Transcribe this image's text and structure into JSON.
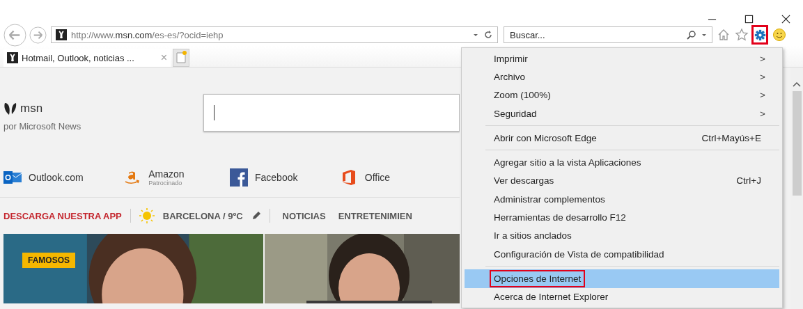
{
  "address_bar": {
    "url": "http://www.**msn.com**/es-es/?ocid=iehp"
  },
  "search": {
    "placeholder": "Buscar..."
  },
  "toolbar": {
    "gear_highlighted": true
  },
  "tabs": [
    {
      "title": "Hotmail, Outlook, noticias ...",
      "selected": true,
      "close": "×"
    }
  ],
  "page": {
    "logo": "msn",
    "tagline": "por Microsoft News",
    "links": [
      {
        "label": "Outlook.com",
        "kind": "outlook"
      },
      {
        "label": "Amazon",
        "sublabel": "Patrocinado",
        "kind": "amazon"
      },
      {
        "label": "Facebook",
        "kind": "facebook"
      },
      {
        "label": "Office",
        "kind": "office"
      }
    ],
    "nav": [
      {
        "label": "DESCARGA NUESTRA APP",
        "kind": "promo"
      },
      {
        "label": "BARCELONA / 9ºC",
        "kind": "weather"
      },
      {
        "label": "NOTICIAS",
        "kind": "link"
      },
      {
        "label": "ENTRETENIMIEN",
        "kind": "link"
      }
    ],
    "cards": [
      {
        "kind": "picture",
        "badge": "FAMOSOS"
      },
      {
        "kind": "picture"
      }
    ]
  },
  "menu": [
    {
      "kind": "item",
      "label": "Imprimir",
      "arrow": ">",
      "selected": false,
      "highlighted": false
    },
    {
      "kind": "item",
      "label": "Archivo",
      "arrow": ">",
      "selected": false,
      "highlighted": false
    },
    {
      "kind": "item",
      "label": "Zoom (100%)",
      "arrow": ">",
      "selected": false,
      "highlighted": false
    },
    {
      "kind": "item",
      "label": "Seguridad",
      "arrow": ">",
      "selected": false,
      "highlighted": false
    },
    {
      "kind": "separator"
    },
    {
      "kind": "item",
      "label": "Abrir con Microsoft Edge",
      "shortcut": "Ctrl+Mayús+E",
      "selected": false,
      "highlighted": false
    },
    {
      "kind": "separator"
    },
    {
      "kind": "item",
      "label": "Agregar sitio a la vista Aplicaciones",
      "selected": false,
      "highlighted": false
    },
    {
      "kind": "item",
      "label": "Ver descargas",
      "shortcut": "Ctrl+J",
      "selected": false,
      "highlighted": false
    },
    {
      "kind": "item",
      "label": "Administrar complementos",
      "selected": false,
      "highlighted": false
    },
    {
      "kind": "item",
      "label": "Herramientas de desarrollo F12",
      "selected": false,
      "highlighted": false
    },
    {
      "kind": "item",
      "label": "Ir a sitios anclados",
      "selected": false,
      "highlighted": false
    },
    {
      "kind": "item",
      "label": "Configuración de Vista de compatibilidad",
      "selected": false,
      "highlighted": false
    },
    {
      "kind": "separator"
    },
    {
      "kind": "item",
      "label": "Opciones de Internet",
      "selected": true,
      "highlighted": true
    },
    {
      "kind": "item",
      "label": "Acerca de Internet Explorer",
      "selected": false,
      "highlighted": false
    }
  ]
}
